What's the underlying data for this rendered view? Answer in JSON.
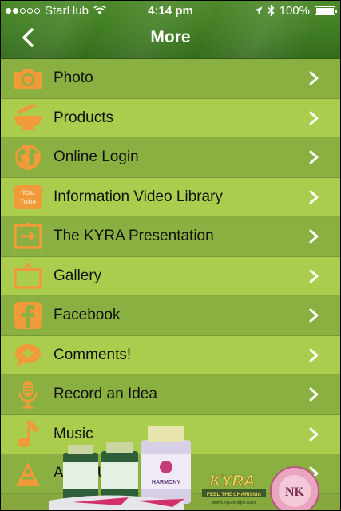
{
  "status_bar": {
    "carrier": "StarHub",
    "time": "4:14 pm",
    "battery": "100%",
    "battery_level": 1.0,
    "signal_bars_filled": 2,
    "signal_bars_total": 5
  },
  "nav": {
    "title": "More",
    "back_icon": "chevron-left-icon"
  },
  "menu": {
    "items": [
      {
        "label": "Photo",
        "icon": "camera-icon"
      },
      {
        "label": "Products",
        "icon": "mortar-pestle-icon"
      },
      {
        "label": "Online Login",
        "icon": "globe-icon"
      },
      {
        "label": "Information Video Library",
        "icon": "youtube-icon"
      },
      {
        "label": "The KYRA Presentation",
        "icon": "presentation-icon"
      },
      {
        "label": "Gallery",
        "icon": "easel-icon"
      },
      {
        "label": "Facebook",
        "icon": "facebook-icon"
      },
      {
        "label": "Comments!",
        "icon": "speech-bubble-icon"
      },
      {
        "label": "Record an Idea",
        "icon": "microphone-icon"
      },
      {
        "label": "Music",
        "icon": "music-note-icon"
      },
      {
        "label": "About Us",
        "icon": "about-logo-icon"
      }
    ]
  },
  "ad": {
    "brand": "KYRA",
    "tagline": "FEEL THE CHARISMA",
    "website": "www.kyraknight.com",
    "product_label": "HARMONY",
    "seal_text": "NK"
  },
  "colors": {
    "icon_orange": "#f09a3a",
    "row_dark": "#8ab042",
    "row_light": "#aacd4e",
    "nav_green": "#3e7a22",
    "chevron": "#ffffff"
  }
}
